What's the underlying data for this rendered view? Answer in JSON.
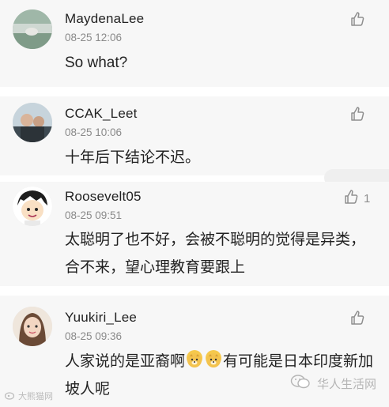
{
  "comments": [
    {
      "name": "MaydenaLee",
      "time": "08-25 12:06",
      "text": "So what?",
      "likes": ""
    },
    {
      "name": "CCAK_Leet",
      "time": "08-25 10:06",
      "text": "十年后下结论不迟。",
      "likes": ""
    },
    {
      "name": "Roosevelt05",
      "time": "08-25 09:51",
      "text": "太聪明了也不好，会被不聪明的觉得是异类，合不来，望心理教育要跟上",
      "likes": "1"
    },
    {
      "name": "Yuukiri_Lee",
      "time": "08-25 09:36",
      "text_before": "人家说的是亚裔啊",
      "text_after": "有可能是日本印度新加坡人呢",
      "likes": ""
    }
  ],
  "watermark_left": "大熊猫网",
  "watermark_right": "华人生活网",
  "icons": {
    "like": "thumbs-up-icon",
    "emoji": "doge-emoji-icon",
    "wechat": "wechat-icon"
  }
}
